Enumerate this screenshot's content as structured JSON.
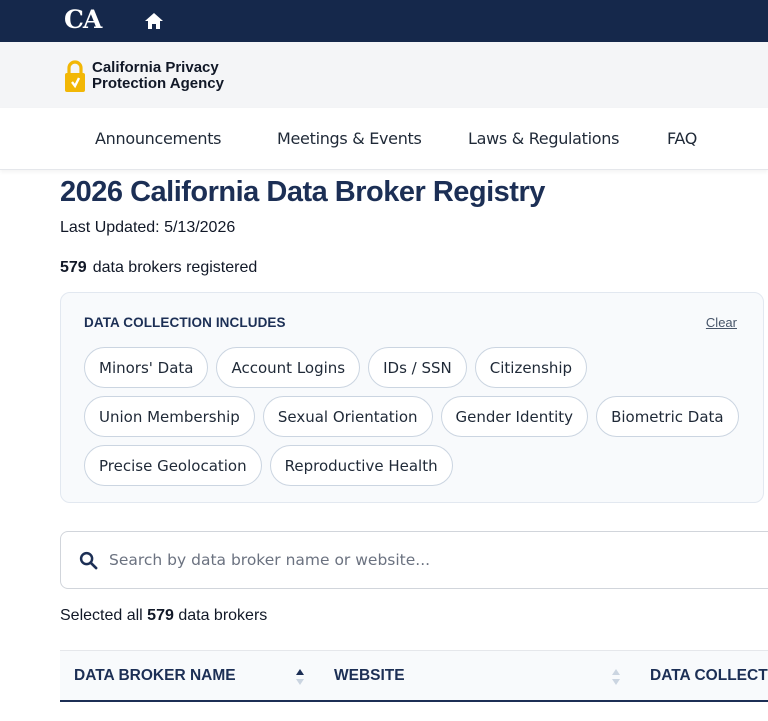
{
  "top_bar": {
    "logo_text": "CA",
    "colors": {
      "background": "#15284b"
    }
  },
  "agency": {
    "name_line1": "California Privacy",
    "name_line2": "Protection Agency",
    "logo_color": "#f2b705"
  },
  "nav": {
    "items": [
      "Announcements",
      "Meetings & Events",
      "Laws & Regulations",
      "FAQ"
    ]
  },
  "page": {
    "title": "2026 California Data Broker Registry",
    "last_updated": "Last Updated: 5/13/2026",
    "broker_count": "579",
    "broker_count_suffix": "data brokers registered"
  },
  "filter": {
    "heading": "DATA COLLECTION INCLUDES",
    "clear_label": "Clear",
    "chips": [
      "Minors' Data",
      "Account Logins",
      "IDs / SSN",
      "Citizenship",
      "Union Membership",
      "Sexual Orientation",
      "Gender Identity",
      "Biometric Data",
      "Precise Geolocation",
      "Reproductive Health"
    ]
  },
  "search": {
    "placeholder": "Search by data broker name or website..."
  },
  "selection": {
    "prefix": "Selected all",
    "count": "579",
    "suffix": "data brokers"
  },
  "table": {
    "columns": [
      "DATA BROKER NAME",
      "WEBSITE",
      "DATA COLLECTI"
    ]
  },
  "colors": {
    "accent": "#1c2f55"
  }
}
